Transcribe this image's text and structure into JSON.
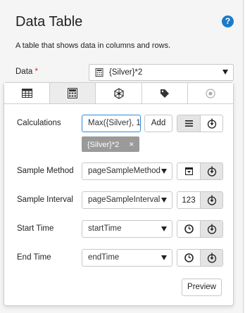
{
  "header": {
    "title": "Data Table",
    "help_glyph": "?",
    "description": "A table that shows data in columns and rows."
  },
  "data_field": {
    "label": "Data",
    "required_mark": "*",
    "value": "{Silver}*2"
  },
  "tabs": [
    {
      "name": "table",
      "icon": "table-icon"
    },
    {
      "name": "calculator",
      "icon": "calculator-icon"
    },
    {
      "name": "network",
      "icon": "network-icon"
    },
    {
      "name": "tag",
      "icon": "tag-icon"
    },
    {
      "name": "other",
      "icon": "radio-target-icon"
    }
  ],
  "calculations": {
    "label": "Calculations",
    "input_value": "Max({Silver}, 1",
    "add_label": "Add",
    "chip": "{Silver}*2",
    "chip_remove": "×"
  },
  "sample_method": {
    "label": "Sample Method",
    "value": "pageSampleMethod"
  },
  "sample_interval": {
    "label": "Sample Interval",
    "value": "pageSampleInterval",
    "number_badge": "123"
  },
  "start_time": {
    "label": "Start Time",
    "value": "startTime"
  },
  "end_time": {
    "label": "End Time",
    "value": "endTime"
  },
  "preview_label": "Preview",
  "colors": {
    "accent": "#1a7bc9",
    "required": "#d9261c",
    "chip_bg": "#9a9a9a",
    "focus_border": "#2a8ae0"
  }
}
